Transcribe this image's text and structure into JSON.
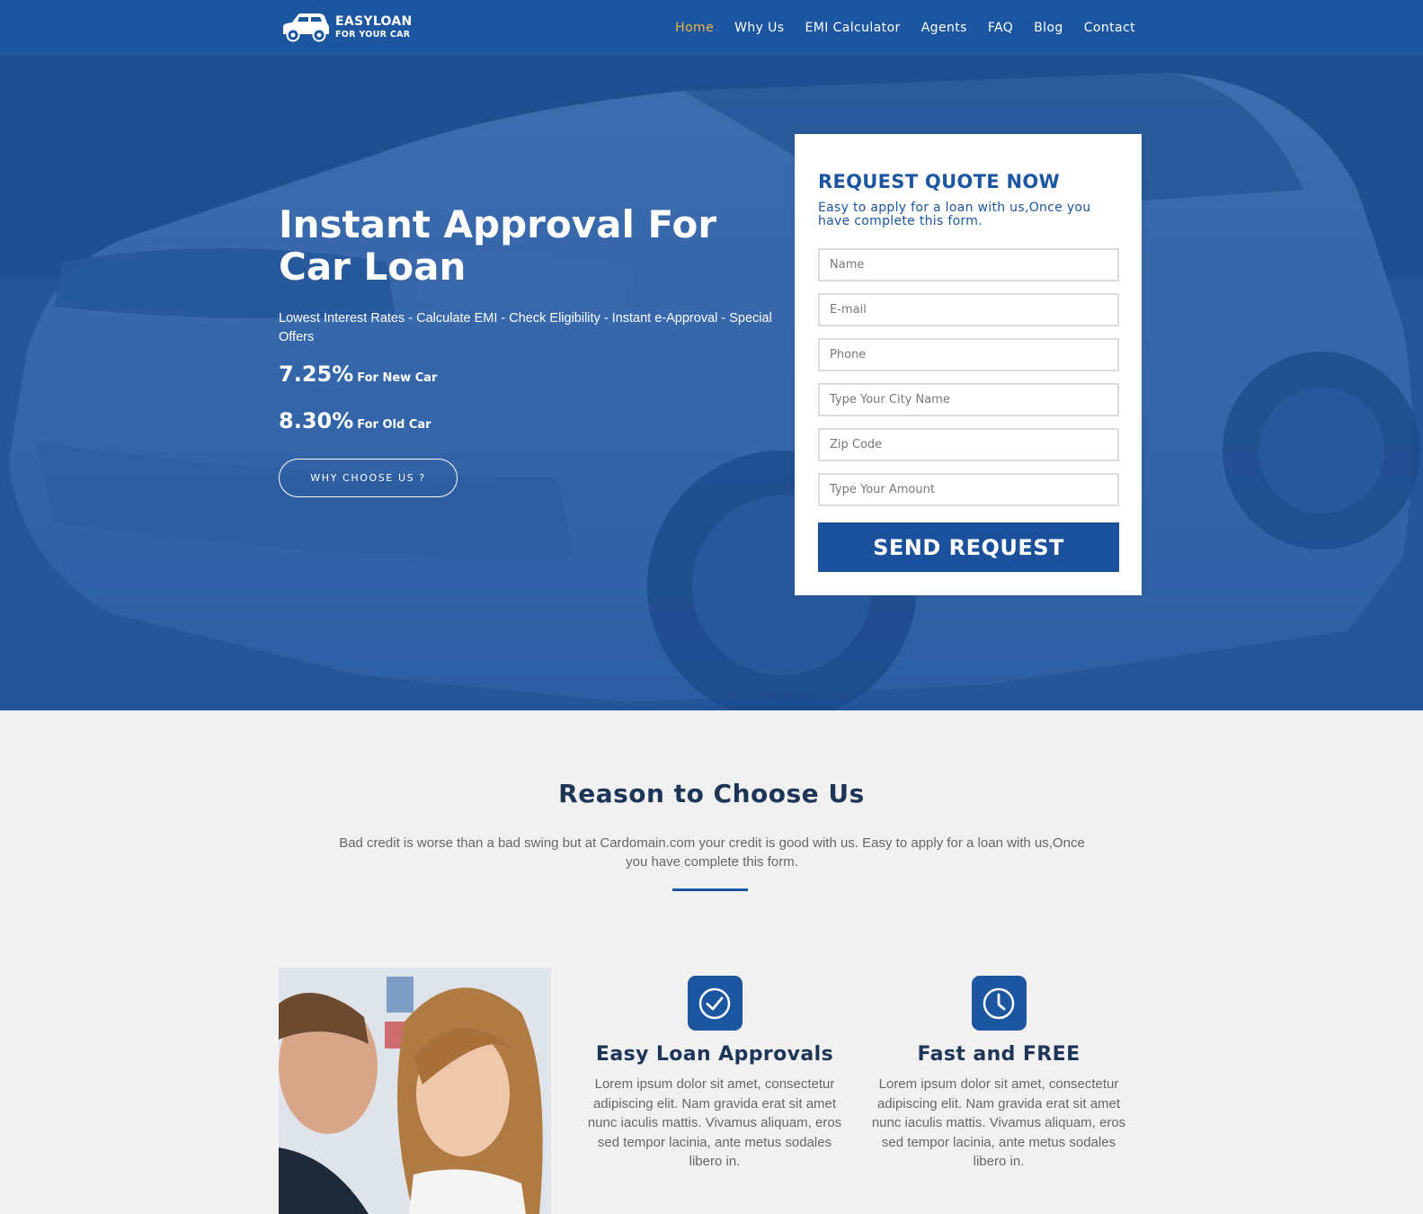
{
  "nav": {
    "logo_brand": "EASYLOAN",
    "logo_tagline": "FOR YOUR CAR",
    "items": [
      {
        "label": "Home",
        "active": true
      },
      {
        "label": "Why Us"
      },
      {
        "label": "EMI Calculator"
      },
      {
        "label": "Agents"
      },
      {
        "label": "FAQ"
      },
      {
        "label": "Blog"
      },
      {
        "label": "Contact"
      }
    ]
  },
  "hero": {
    "title": "Instant Approval For Car Loan",
    "subtitle": "Lowest Interest Rates - Calculate EMI - Check Eligibility - Instant e-Approval - Special Offers",
    "rates": [
      {
        "value": "7.25%",
        "label": "For New Car"
      },
      {
        "value": "8.30%",
        "label": "For Old Car"
      }
    ],
    "cta_label": "WHY CHOOSE US ?"
  },
  "quote": {
    "title": "REQUEST QUOTE NOW",
    "description": "Easy to apply for a loan with us,Once you have complete this form.",
    "fields": {
      "name": "Name",
      "email": "E-mail",
      "phone": "Phone",
      "city": "Type Your City Name",
      "zip": "Zip Code",
      "amount": "Type Your Amount"
    },
    "submit_label": "SEND REQUEST"
  },
  "reasons": {
    "title": "Reason to Choose Us",
    "description": "Bad credit is worse than a bad swing but at Cardomain.com your credit is good with us. Easy to apply for a loan with us,Once you have complete this form.",
    "features": [
      {
        "title": "Easy Loan Approvals",
        "icon": "check-circle-icon",
        "text": "Lorem ipsum dolor sit amet, consectetur adipiscing elit. Nam gravida erat sit amet nunc iaculis mattis. Vivamus aliquam, eros sed tempor lacinia, ante metus sodales libero in."
      },
      {
        "title": "Fast and FREE",
        "icon": "clock-icon",
        "text": "Lorem ipsum dolor sit amet, consectetur adipiscing elit. Nam gravida erat sit amet nunc iaculis mattis. Vivamus aliquam, eros sed tempor lacinia, ante metus sodales libero in."
      }
    ]
  },
  "colors": {
    "primary": "#1c56a0",
    "nav_active": "#f0b542",
    "heading_dark": "#1d3557",
    "page_bg": "#f1f1f1"
  }
}
